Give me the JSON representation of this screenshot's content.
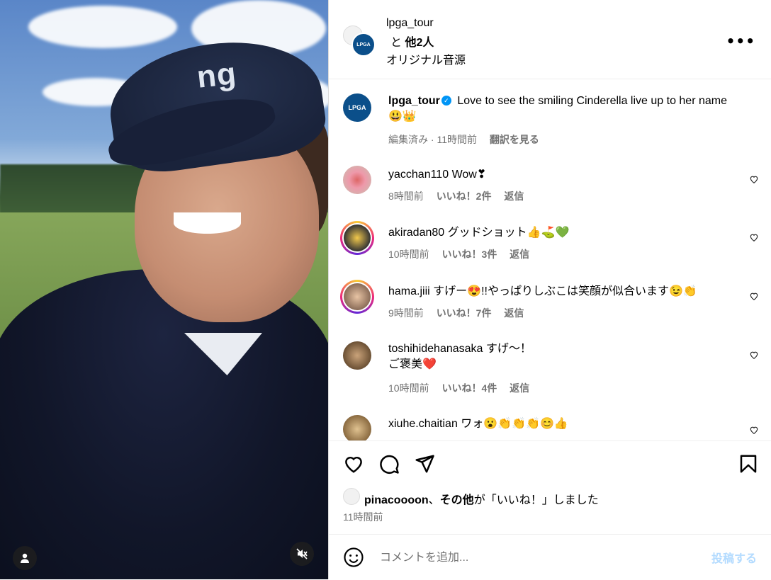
{
  "header": {
    "username": "lpga_tour",
    "collab_prefix": "と",
    "collab_others": "他2人",
    "audio": "オリジナル音源",
    "more_icon": "more-horizontal-icon"
  },
  "caption": {
    "username": "lpga_tour",
    "text": "Love to see the smiling Cinderella live up to her name 😃👑",
    "meta_edited": "編集済み · 11時間前",
    "translate": "翻訳を見る",
    "avatar_label": "LPGA"
  },
  "comments": [
    {
      "username": "yacchan110",
      "text": "Wow❣",
      "time": "8時間前",
      "likes": "いいね！2件",
      "reply": "返信"
    },
    {
      "username": "akiradan80",
      "text": "グッドショット👍⛳💚",
      "time": "10時間前",
      "likes": "いいね！3件",
      "reply": "返信"
    },
    {
      "username": "hama.jiii",
      "text": "すげー😍!!やっぱりしぶこは笑顔が似合います😉👏",
      "time": "9時間前",
      "likes": "いいね！7件",
      "reply": "返信"
    },
    {
      "username": "toshihidehanasaka",
      "text": "すげ〜！",
      "text2": "ご褒美❤️",
      "time": "10時間前",
      "likes": "いいね！4件",
      "reply": "返信"
    },
    {
      "username": "xiuhe.chaitian",
      "text": "ワォ😮👏👏👏😊👍"
    }
  ],
  "actions": {
    "liked_by_user": "pinacoooon",
    "liked_sep": "、",
    "liked_others": "その他",
    "liked_suffix": "が「いいね！」しました",
    "timestamp": "11時間前"
  },
  "composer": {
    "placeholder": "コメントを追加...",
    "post_label": "投稿する"
  },
  "video": {
    "cap_text": "ng",
    "mute_icon": "muted-speaker-icon",
    "user_tag_icon": "person-icon"
  },
  "colors": {
    "accent": "#0095f6",
    "post_disabled": "#b3dbff",
    "meta_text": "#737373",
    "lpga_blue": "#0b4f8a"
  }
}
